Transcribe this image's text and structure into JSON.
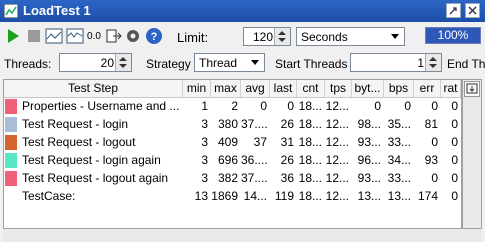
{
  "window": {
    "title": "LoadTest 1"
  },
  "toolbar": {
    "icons": [
      "play-icon",
      "stop-icon",
      "graph-icon",
      "stats-icon",
      "zero-icon",
      "export-icon",
      "gear-icon",
      "help-icon"
    ],
    "zero_label": "0.0",
    "limit_label": "Limit:",
    "limit_value": "120",
    "limit_unit": "Seconds",
    "progress": "100%"
  },
  "controls": {
    "threads_label": "Threads:",
    "threads_value": "20",
    "strategy_label": "Strategy",
    "strategy_value": "Thread",
    "start_threads_label": "Start Threads",
    "start_threads_value": "1",
    "end_label": "End Th"
  },
  "table": {
    "columns": [
      "Test Step",
      "min",
      "max",
      "avg",
      "last",
      "cnt",
      "tps",
      "byt...",
      "bps",
      "err",
      "rat"
    ],
    "rows": [
      {
        "color": "#f0607a",
        "name": "Properties - Username and ...",
        "min": "1",
        "max": "2",
        "avg": "0",
        "last": "0",
        "cnt": "18...",
        "tps": "12...",
        "bytes": "0",
        "bps": "0",
        "err": "0",
        "rat": "0"
      },
      {
        "color": "#a9bdd8",
        "name": "Test Request - login",
        "min": "3",
        "max": "380",
        "avg": "37....",
        "last": "26",
        "cnt": "18...",
        "tps": "12...",
        "bytes": "98...",
        "bps": "35...",
        "err": "81",
        "rat": "0"
      },
      {
        "color": "#d4642c",
        "name": "Test Request - logout",
        "min": "3",
        "max": "409",
        "avg": "37",
        "last": "31",
        "cnt": "18...",
        "tps": "12...",
        "bytes": "93...",
        "bps": "33...",
        "err": "0",
        "rat": "0"
      },
      {
        "color": "#58e6c4",
        "name": "Test Request - login again",
        "min": "3",
        "max": "696",
        "avg": "36....",
        "last": "26",
        "cnt": "18...",
        "tps": "12...",
        "bytes": "96...",
        "bps": "34...",
        "err": "93",
        "rat": "0"
      },
      {
        "color": "#f0607a",
        "name": "Test Request - logout again",
        "min": "3",
        "max": "382",
        "avg": "37....",
        "last": "36",
        "cnt": "18...",
        "tps": "12...",
        "bytes": "93...",
        "bps": "33...",
        "err": "0",
        "rat": "0"
      },
      {
        "color": "",
        "name": "TestCase:",
        "min": "13",
        "max": "1869",
        "avg": "14...",
        "last": "119",
        "cnt": "18...",
        "tps": "12...",
        "bytes": "13...",
        "bps": "13...",
        "err": "174",
        "rat": "0"
      }
    ]
  }
}
